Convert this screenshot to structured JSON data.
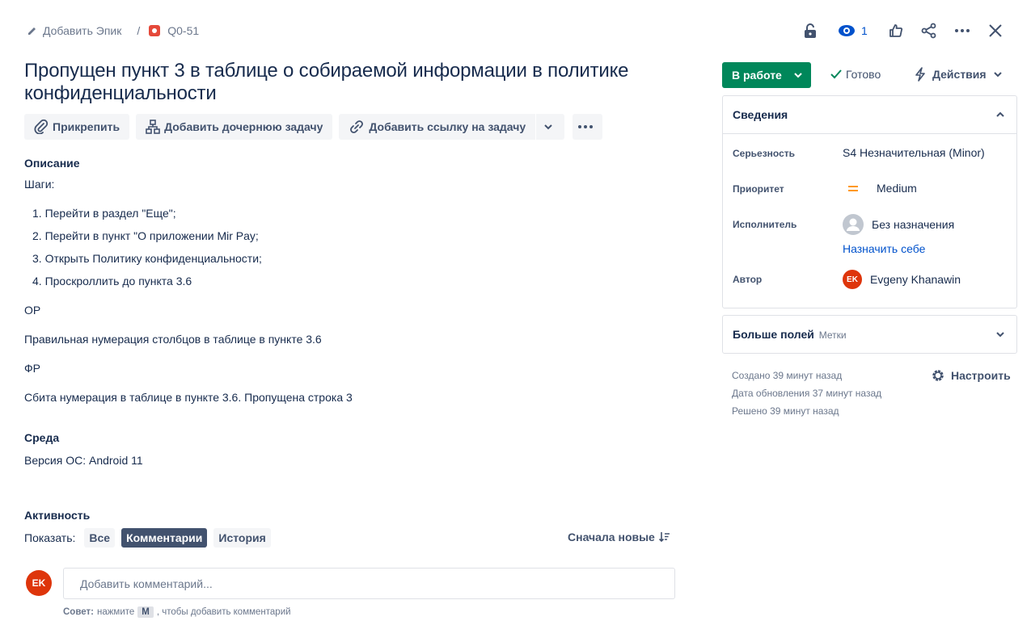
{
  "breadcrumb": {
    "add_epic": "Добавить Эпик",
    "separator": "/",
    "issue_key": "Q0-51"
  },
  "header": {
    "watchers_count": "1"
  },
  "issue": {
    "title": "Пропущен пункт 3 в таблице о собираемой информации в политике конфиденциальности"
  },
  "toolbar": {
    "attach": "Прикрепить",
    "add_child": "Добавить дочернюю задачу",
    "add_link": "Добавить ссылку на задачу"
  },
  "description": {
    "heading": "Описание",
    "steps_label": "Шаги:",
    "steps": [
      "1. Перейти в раздел \"Еще\";",
      "2. Перейти в пункт \"О приложении Mir Pay;",
      "3. Открыть Политику конфиденциальности;",
      "4. Проскроллить до пункта 3.6"
    ],
    "expected_label": "ОР",
    "expected_text": "Правильная нумерация столбцов в таблице в пункте 3.6",
    "actual_label": "ФР",
    "actual_text": "Сбита нумерация в таблице в пункте 3.6. Пропущена строка 3"
  },
  "environment": {
    "heading": "Среда",
    "text": "Версия ОС: Android 11"
  },
  "activity": {
    "heading": "Активность",
    "show_label": "Показать:",
    "filters": [
      "Все",
      "Комментарии",
      "История"
    ],
    "active_filter": "Комментарии",
    "sort_label": "Сначала новые",
    "user_initials": "EK",
    "comment_placeholder": "Добавить комментарий...",
    "tip_bold": "Совет:",
    "tip_pre": "нажмите",
    "tip_key": "M",
    "tip_post": ", чтобы добавить комментарий"
  },
  "sidebar": {
    "status": "В работе",
    "done": "Готово",
    "actions": "Действия",
    "details_title": "Сведения",
    "fields": {
      "severity_label": "Серьезность",
      "severity_value": "S4 Незначительная (Minor)",
      "priority_label": "Приоритет",
      "priority_value": "Medium",
      "assignee_label": "Исполнитель",
      "assignee_value": "Без назначения",
      "assign_me": "Назначить себе",
      "reporter_label": "Автор",
      "reporter_initials": "EK",
      "reporter_value": "Evgeny Khanawin"
    },
    "more_fields": "Больше полей",
    "more_fields_hint": "Метки",
    "created": "Создано 39 минут назад",
    "updated": "Дата обновления 37 минут назад",
    "resolved": "Решено 39 минут назад",
    "configure": "Настроить"
  },
  "colors": {
    "status_green": "#00875a",
    "link_blue": "#0052cc",
    "avatar_red": "#de350b",
    "priority_orange": "#ff991f"
  }
}
